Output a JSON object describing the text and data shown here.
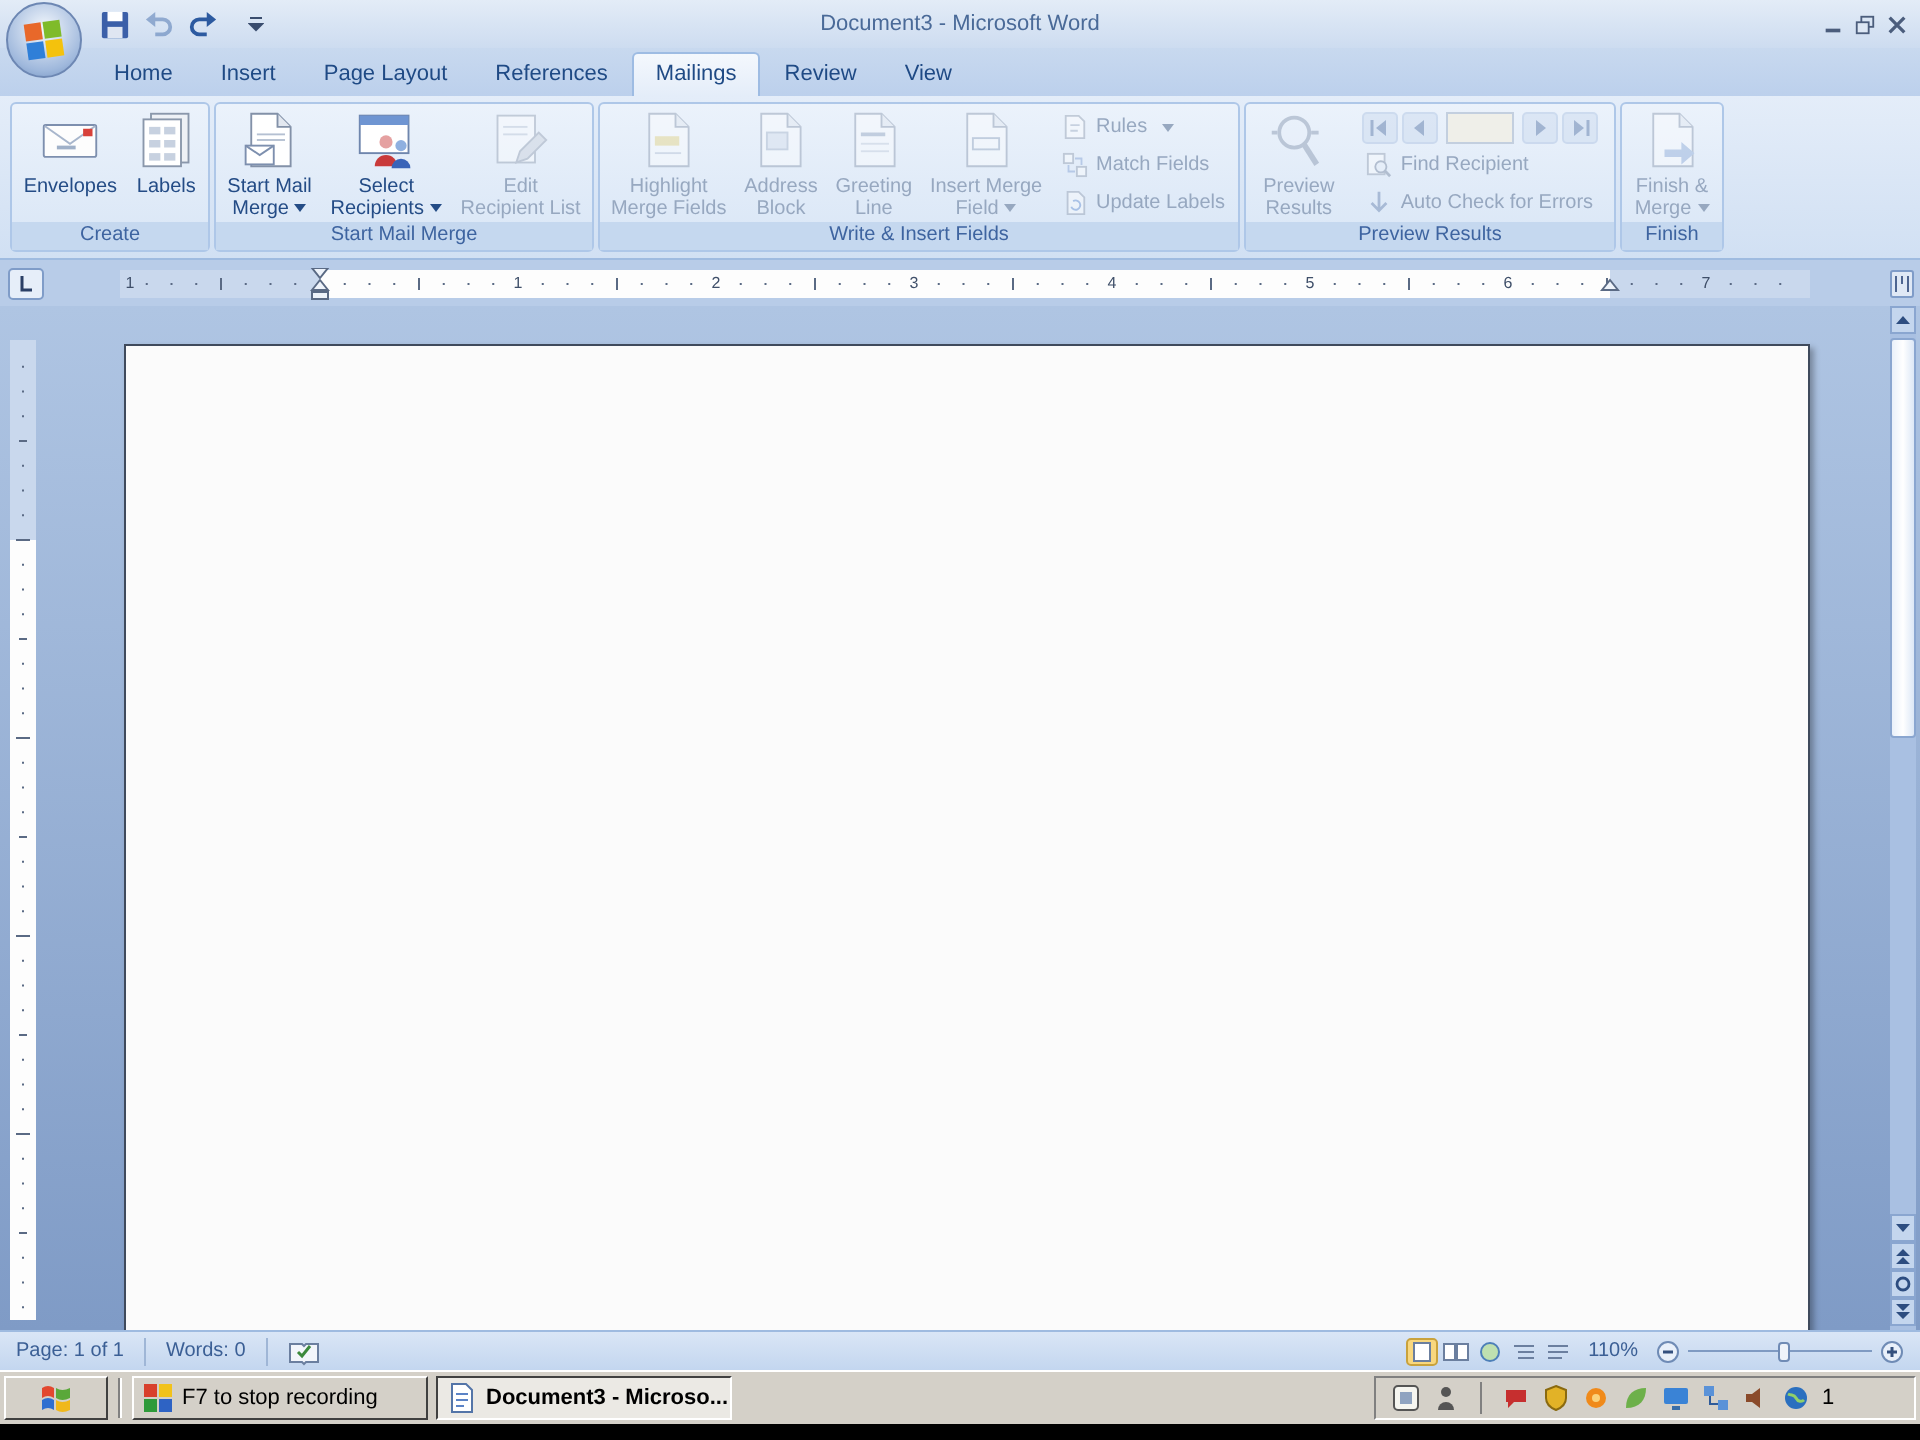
{
  "window": {
    "title": "Document3 - Microsoft Word"
  },
  "quick_access": [
    {
      "disabled": false
    },
    {
      "disabled": true
    },
    {
      "disabled": false
    }
  ],
  "tabs": [
    {
      "label": "Home",
      "selected": false
    },
    {
      "label": "Insert",
      "selected": false
    },
    {
      "label": "Page Layout",
      "selected": false
    },
    {
      "label": "References",
      "selected": false
    },
    {
      "label": "Mailings",
      "selected": true
    },
    {
      "label": "Review",
      "selected": false
    },
    {
      "label": "View",
      "selected": false
    }
  ],
  "ribbon": {
    "groups": [
      {
        "title": "Create",
        "items": [
          {
            "kind": "large",
            "lines": [
              "Envelopes"
            ],
            "disabled": false
          },
          {
            "kind": "large",
            "lines": [
              "Labels"
            ],
            "disabled": false
          }
        ]
      },
      {
        "title": "Start Mail Merge",
        "items": [
          {
            "kind": "large",
            "lines": [
              "Start Mail",
              "Merge"
            ],
            "disabled": false,
            "dropdown": true
          },
          {
            "kind": "large",
            "lines": [
              "Select",
              "Recipients"
            ],
            "disabled": false,
            "dropdown": true
          },
          {
            "kind": "large",
            "lines": [
              "Edit",
              "Recipient List"
            ],
            "disabled": true
          }
        ]
      },
      {
        "title": "Write & Insert Fields",
        "items": [
          {
            "kind": "large",
            "lines": [
              "Highlight",
              "Merge Fields"
            ],
            "disabled": true
          },
          {
            "kind": "large",
            "lines": [
              "Address",
              "Block"
            ],
            "disabled": true
          },
          {
            "kind": "large",
            "lines": [
              "Greeting",
              "Line"
            ],
            "disabled": true
          },
          {
            "kind": "large",
            "lines": [
              "Insert Merge",
              "Field"
            ],
            "disabled": true,
            "dropdown": true
          },
          {
            "kind": "stack",
            "entries": [
              {
                "label": "Rules",
                "disabled": true,
                "dropdown": true
              },
              {
                "label": "Match Fields",
                "disabled": true
              },
              {
                "label": "Update Labels",
                "disabled": true
              }
            ]
          }
        ]
      },
      {
        "title": "Preview Results",
        "items": [
          {
            "kind": "large",
            "lines": [
              "Preview",
              "Results"
            ],
            "disabled": true
          },
          {
            "kind": "navigator",
            "disabled": true,
            "entries": [
              {
                "label": "Find Recipient",
                "disabled": true
              },
              {
                "label": "Auto Check for Errors",
                "disabled": true
              }
            ]
          }
        ]
      },
      {
        "title": "Finish",
        "items": [
          {
            "kind": "large",
            "lines": [
              "Finish &",
              "Merge"
            ],
            "disabled": true,
            "dropdown": true
          }
        ]
      }
    ]
  },
  "ruler": {
    "left_numbers": [
      "1"
    ],
    "numbers": [
      "1",
      "2",
      "3",
      "4",
      "5",
      "6",
      "7"
    ]
  },
  "status_bar": {
    "page": "Page: 1 of 1",
    "words": "Words: 0",
    "view_buttons": [
      {
        "selected": true
      },
      {
        "selected": false
      },
      {
        "selected": false
      },
      {
        "selected": false
      },
      {
        "selected": false
      }
    ],
    "zoom": {
      "reading": "110%",
      "level": 0.52
    }
  },
  "taskbar": {
    "tasks": [
      {
        "label": "F7 to stop recording",
        "selected": false
      },
      {
        "label": "Document3 - Microso...",
        "selected": true
      }
    ],
    "clock": "1"
  }
}
